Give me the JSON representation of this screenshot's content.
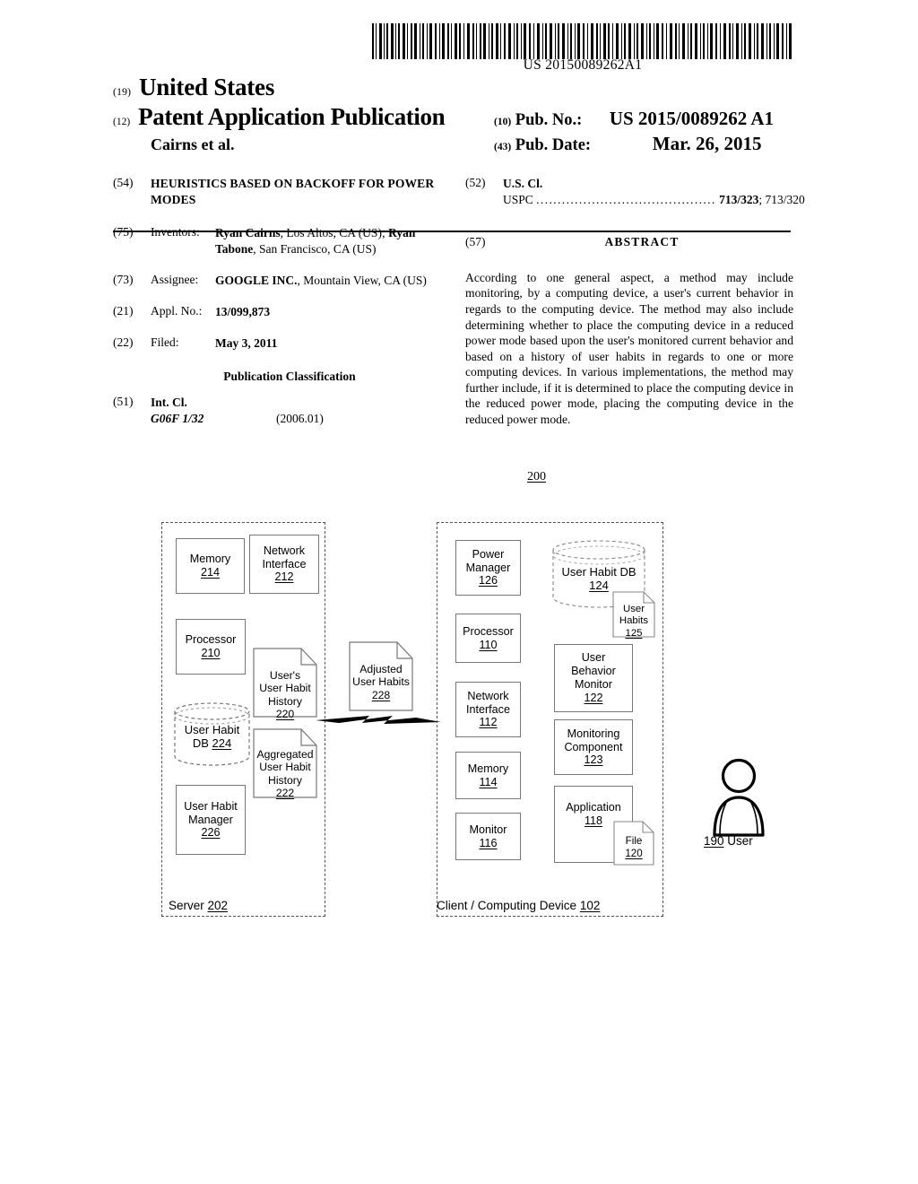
{
  "barcode": {
    "number": "US 20150089262A1"
  },
  "header": {
    "country_num": "(19)",
    "country": "United States",
    "doc_type_num": "(12)",
    "doc_type": "Patent Application Publication",
    "authors": "Cairns et al.",
    "pubno_num": "(10)",
    "pubno_label": "Pub. No.:",
    "pubno_value": "US 2015/0089262 A1",
    "pubdate_num": "(43)",
    "pubdate_label": "Pub. Date:",
    "pubdate_value": "Mar. 26, 2015"
  },
  "biblio": {
    "title_num": "(54)",
    "title": "HEURISTICS BASED ON BACKOFF FOR POWER MODES",
    "inventors_num": "(75)",
    "inventors_label": "Inventors:",
    "inventor_1_name": "Ryan Cairns",
    "inventor_1_rest": ", Los Altos, CA (US); ",
    "inventor_2_name": "Ryan Tabone",
    "inventor_2_rest": ", San Francisco, CA (US)",
    "assignee_num": "(73)",
    "assignee_label": "Assignee:",
    "assignee_name": "GOOGLE INC.",
    "assignee_rest": ", Mountain View, CA (US)",
    "applno_num": "(21)",
    "applno_label": "Appl. No.:",
    "applno_value": "13/099,873",
    "filed_num": "(22)",
    "filed_label": "Filed:",
    "filed_value": "May 3, 2011",
    "pubclass_heading": "Publication Classification",
    "intcl_num": "(51)",
    "intcl_label": "Int. Cl.",
    "intcl_code": "G06F 1/32",
    "intcl_version": "(2006.01)"
  },
  "uscl": {
    "num": "(52)",
    "label": "U.S. Cl.",
    "uspc_label": "USPC",
    "dots": "..........................................",
    "primary": "713/323",
    "secondary": "; 713/320"
  },
  "abstract": {
    "num": "(57)",
    "title": "ABSTRACT",
    "text": "According to one general aspect, a method may include monitoring, by a computing device, a user's current behavior in regards to the computing device. The method may also include determining whether to place the computing device in a reduced power mode based upon the user's monitored current behavior and based on a history of user habits in regards to one or more computing devices. In various implementations, the method may further include, if it is determined to place the computing device in the reduced power mode, placing the computing device in the reduced power mode."
  },
  "figure": {
    "fig_number": "200",
    "server": {
      "label_text": "Server ",
      "label_ref": "202",
      "boxes": [
        {
          "name": "memory",
          "lines": [
            "Memory"
          ],
          "ref": "214"
        },
        {
          "name": "network-interface",
          "lines": [
            "Network",
            "Interface"
          ],
          "ref": "212"
        },
        {
          "name": "processor",
          "lines": [
            "Processor"
          ],
          "ref": "210"
        },
        {
          "name": "user-habit-manager",
          "lines": [
            "User Habit",
            "Manager"
          ],
          "ref": "226"
        }
      ],
      "cylinder": {
        "lines": [
          "User Habit",
          "DB "
        ],
        "ref": "224"
      },
      "documents": [
        {
          "name": "users-user-habit-history",
          "lines": [
            "User's",
            "User Habit",
            "History"
          ],
          "ref": "220"
        },
        {
          "name": "aggregated-user-habit-history",
          "lines": [
            "Aggregated",
            "User Habit",
            "History"
          ],
          "ref": "222"
        }
      ]
    },
    "link": {
      "document": {
        "name": "adjusted-user-habits",
        "lines": [
          "Adjusted",
          "User Habits"
        ],
        "ref": "228"
      }
    },
    "client": {
      "label_text": "Client / Computing Device ",
      "label_ref": "102",
      "boxes_left": [
        {
          "name": "power-manager",
          "lines": [
            "Power",
            "Manager"
          ],
          "ref": "126"
        },
        {
          "name": "processor",
          "lines": [
            "Processor"
          ],
          "ref": "110"
        },
        {
          "name": "network-interface",
          "lines": [
            "Network",
            "Interface"
          ],
          "ref": "112"
        },
        {
          "name": "memory",
          "lines": [
            "Memory"
          ],
          "ref": "114"
        },
        {
          "name": "monitor",
          "lines": [
            "Monitor"
          ],
          "ref": "116"
        }
      ],
      "boxes_right": [
        {
          "name": "user-behavior-monitor",
          "lines": [
            "User",
            "Behavior",
            "Monitor"
          ],
          "ref": "122"
        },
        {
          "name": "monitoring-component",
          "lines": [
            "Monitoring",
            "Component"
          ],
          "ref": "123"
        },
        {
          "name": "application",
          "lines": [
            "Application"
          ],
          "ref": "118"
        }
      ],
      "cylinder": {
        "lines": [
          "User Habit DB"
        ],
        "ref": "124"
      },
      "documents": [
        {
          "name": "user-habits",
          "lines": [
            "User",
            "Habits"
          ],
          "ref": "125"
        },
        {
          "name": "file",
          "lines": [
            "File"
          ],
          "ref": "120"
        }
      ]
    },
    "user": {
      "ref": "190",
      "label": " User"
    }
  }
}
